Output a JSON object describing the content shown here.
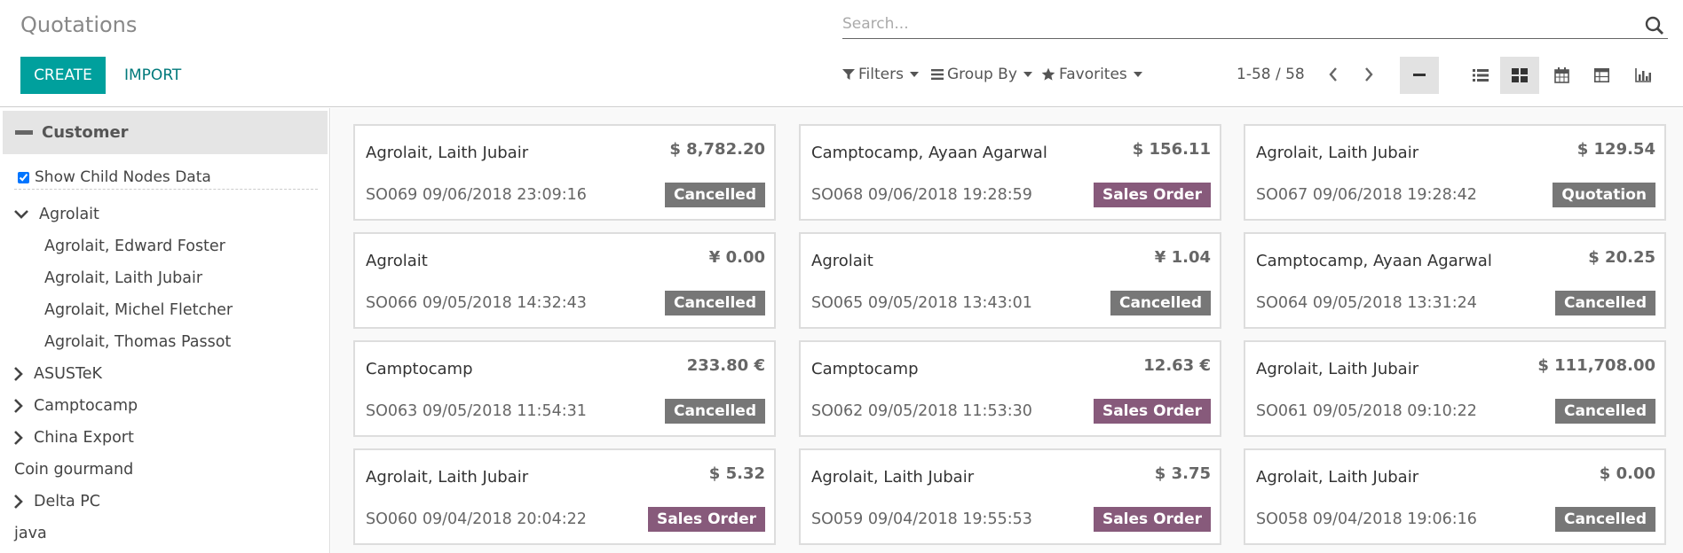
{
  "header": {
    "title": "Quotations",
    "create_label": "CREATE",
    "import_label": "IMPORT",
    "search_placeholder": "Search...",
    "filters_label": "Filters",
    "groupby_label": "Group By",
    "favorites_label": "Favorites",
    "pager": "1-58 / 58"
  },
  "sidebar": {
    "heading": "Customer",
    "child_nodes_label": "Show Child Nodes Data",
    "child_nodes_checked": true,
    "tree": [
      {
        "label": "Agrolait",
        "toggle": "expanded",
        "indent": 0
      },
      {
        "label": "Agrolait, Edward Foster",
        "toggle": "none",
        "indent": 1
      },
      {
        "label": "Agrolait, Laith Jubair",
        "toggle": "none",
        "indent": 1
      },
      {
        "label": "Agrolait, Michel Fletcher",
        "toggle": "none",
        "indent": 1
      },
      {
        "label": "Agrolait, Thomas Passot",
        "toggle": "none",
        "indent": 1
      },
      {
        "label": "ASUSTeK",
        "toggle": "collapsed",
        "indent": 0
      },
      {
        "label": "Camptocamp",
        "toggle": "collapsed",
        "indent": 0
      },
      {
        "label": "China Export",
        "toggle": "collapsed",
        "indent": 0
      },
      {
        "label": "Coin gourmand",
        "toggle": "none",
        "indent": 0
      },
      {
        "label": "Delta PC",
        "toggle": "collapsed",
        "indent": 0
      },
      {
        "label": "java",
        "toggle": "none",
        "indent": 0
      }
    ]
  },
  "cards": [
    {
      "name": "Agrolait, Laith Jubair",
      "amount": "$ 8,782.20",
      "ref": "SO069 09/06/2018 23:09:16",
      "status": "Cancelled",
      "status_type": "cancelled"
    },
    {
      "name": "Camptocamp, Ayaan Agarwal",
      "amount": "$ 156.11",
      "ref": "SO068 09/06/2018 19:28:59",
      "status": "Sales Order",
      "status_type": "sale"
    },
    {
      "name": "Agrolait, Laith Jubair",
      "amount": "$ 129.54",
      "ref": "SO067 09/06/2018 19:28:42",
      "status": "Quotation",
      "status_type": "quotation"
    },
    {
      "name": "Agrolait",
      "amount": "¥ 0.00",
      "ref": "SO066 09/05/2018 14:32:43",
      "status": "Cancelled",
      "status_type": "cancelled"
    },
    {
      "name": "Agrolait",
      "amount": "¥ 1.04",
      "ref": "SO065 09/05/2018 13:43:01",
      "status": "Cancelled",
      "status_type": "cancelled"
    },
    {
      "name": "Camptocamp, Ayaan Agarwal",
      "amount": "$ 20.25",
      "ref": "SO064 09/05/2018 13:31:24",
      "status": "Cancelled",
      "status_type": "cancelled"
    },
    {
      "name": "Camptocamp",
      "amount": "233.80 €",
      "ref": "SO063 09/05/2018 11:54:31",
      "status": "Cancelled",
      "status_type": "cancelled"
    },
    {
      "name": "Camptocamp",
      "amount": "12.63 €",
      "ref": "SO062 09/05/2018 11:53:30",
      "status": "Sales Order",
      "status_type": "sale"
    },
    {
      "name": "Agrolait, Laith Jubair",
      "amount": "$ 111,708.00",
      "ref": "SO061 09/05/2018 09:10:22",
      "status": "Cancelled",
      "status_type": "cancelled"
    },
    {
      "name": "Agrolait, Laith Jubair",
      "amount": "$ 5.32",
      "ref": "SO060 09/04/2018 20:04:22",
      "status": "Sales Order",
      "status_type": "sale"
    },
    {
      "name": "Agrolait, Laith Jubair",
      "amount": "$ 3.75",
      "ref": "SO059 09/04/2018 19:55:53",
      "status": "Sales Order",
      "status_type": "sale"
    },
    {
      "name": "Agrolait, Laith Jubair",
      "amount": "$ 0.00",
      "ref": "SO058 09/04/2018 19:06:16",
      "status": "Cancelled",
      "status_type": "cancelled"
    }
  ],
  "colors": {
    "accent": "#00a09d",
    "sales_order_badge": "#875a7b",
    "cancelled_badge": "#777777"
  },
  "icons": [
    "search-icon",
    "filter-icon",
    "group-by-icon",
    "star-icon",
    "chevron-left-icon",
    "chevron-right-icon",
    "minus-icon",
    "list-view-icon",
    "kanban-view-icon",
    "calendar-view-icon",
    "pivot-view-icon",
    "graph-view-icon"
  ]
}
